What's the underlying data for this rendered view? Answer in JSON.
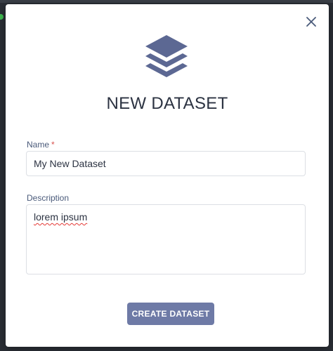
{
  "colors": {
    "accent": "#6e7aa6",
    "icon": "#5c6893",
    "required": "#d9534f",
    "title": "#2c3342"
  },
  "modal": {
    "close_icon": "close-icon",
    "hero_icon": "layers-icon",
    "title": "NEW DATASET",
    "name_field": {
      "label": "Name",
      "required_mark": "*",
      "value": "My New Dataset"
    },
    "description_field": {
      "label": "Description",
      "value": "lorem ipsum"
    },
    "submit_label": "CREATE DATASET"
  }
}
